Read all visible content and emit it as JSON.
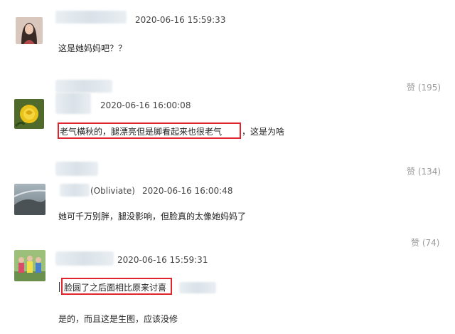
{
  "comments": [
    {
      "timestamp": "2020-06-16 15:59:33",
      "text": "这是她妈妈吧？？",
      "likes": "赞 (195)",
      "avatar_icon": "woman-portrait-avatar"
    },
    {
      "timestamp": "2020-06-16 16:00:08",
      "text_highlight": "老气横秋的，腿漂亮但是脚看起来也很老气",
      "text_rest": "，这是为啥",
      "likes": "赞 (134)",
      "avatar_icon": "yellow-rose-avatar",
      "highlight_color": "#e2242c"
    },
    {
      "username_suffix": "(Obliviate)",
      "timestamp": "2020-06-16 16:00:48",
      "text": "她可千万别胖，腿没影响，但脸真的太像她妈妈了",
      "likes": "赞 (74)",
      "avatar_icon": "landscape-avatar"
    },
    {
      "timestamp": "2020-06-16 15:59:31",
      "text_highlight": "脸圆了之后面相比原来讨喜",
      "reply_text": "是的，而且这是生图，应该没修",
      "avatar_icon": "group-photo-avatar",
      "highlight_color": "#e2242c"
    }
  ]
}
